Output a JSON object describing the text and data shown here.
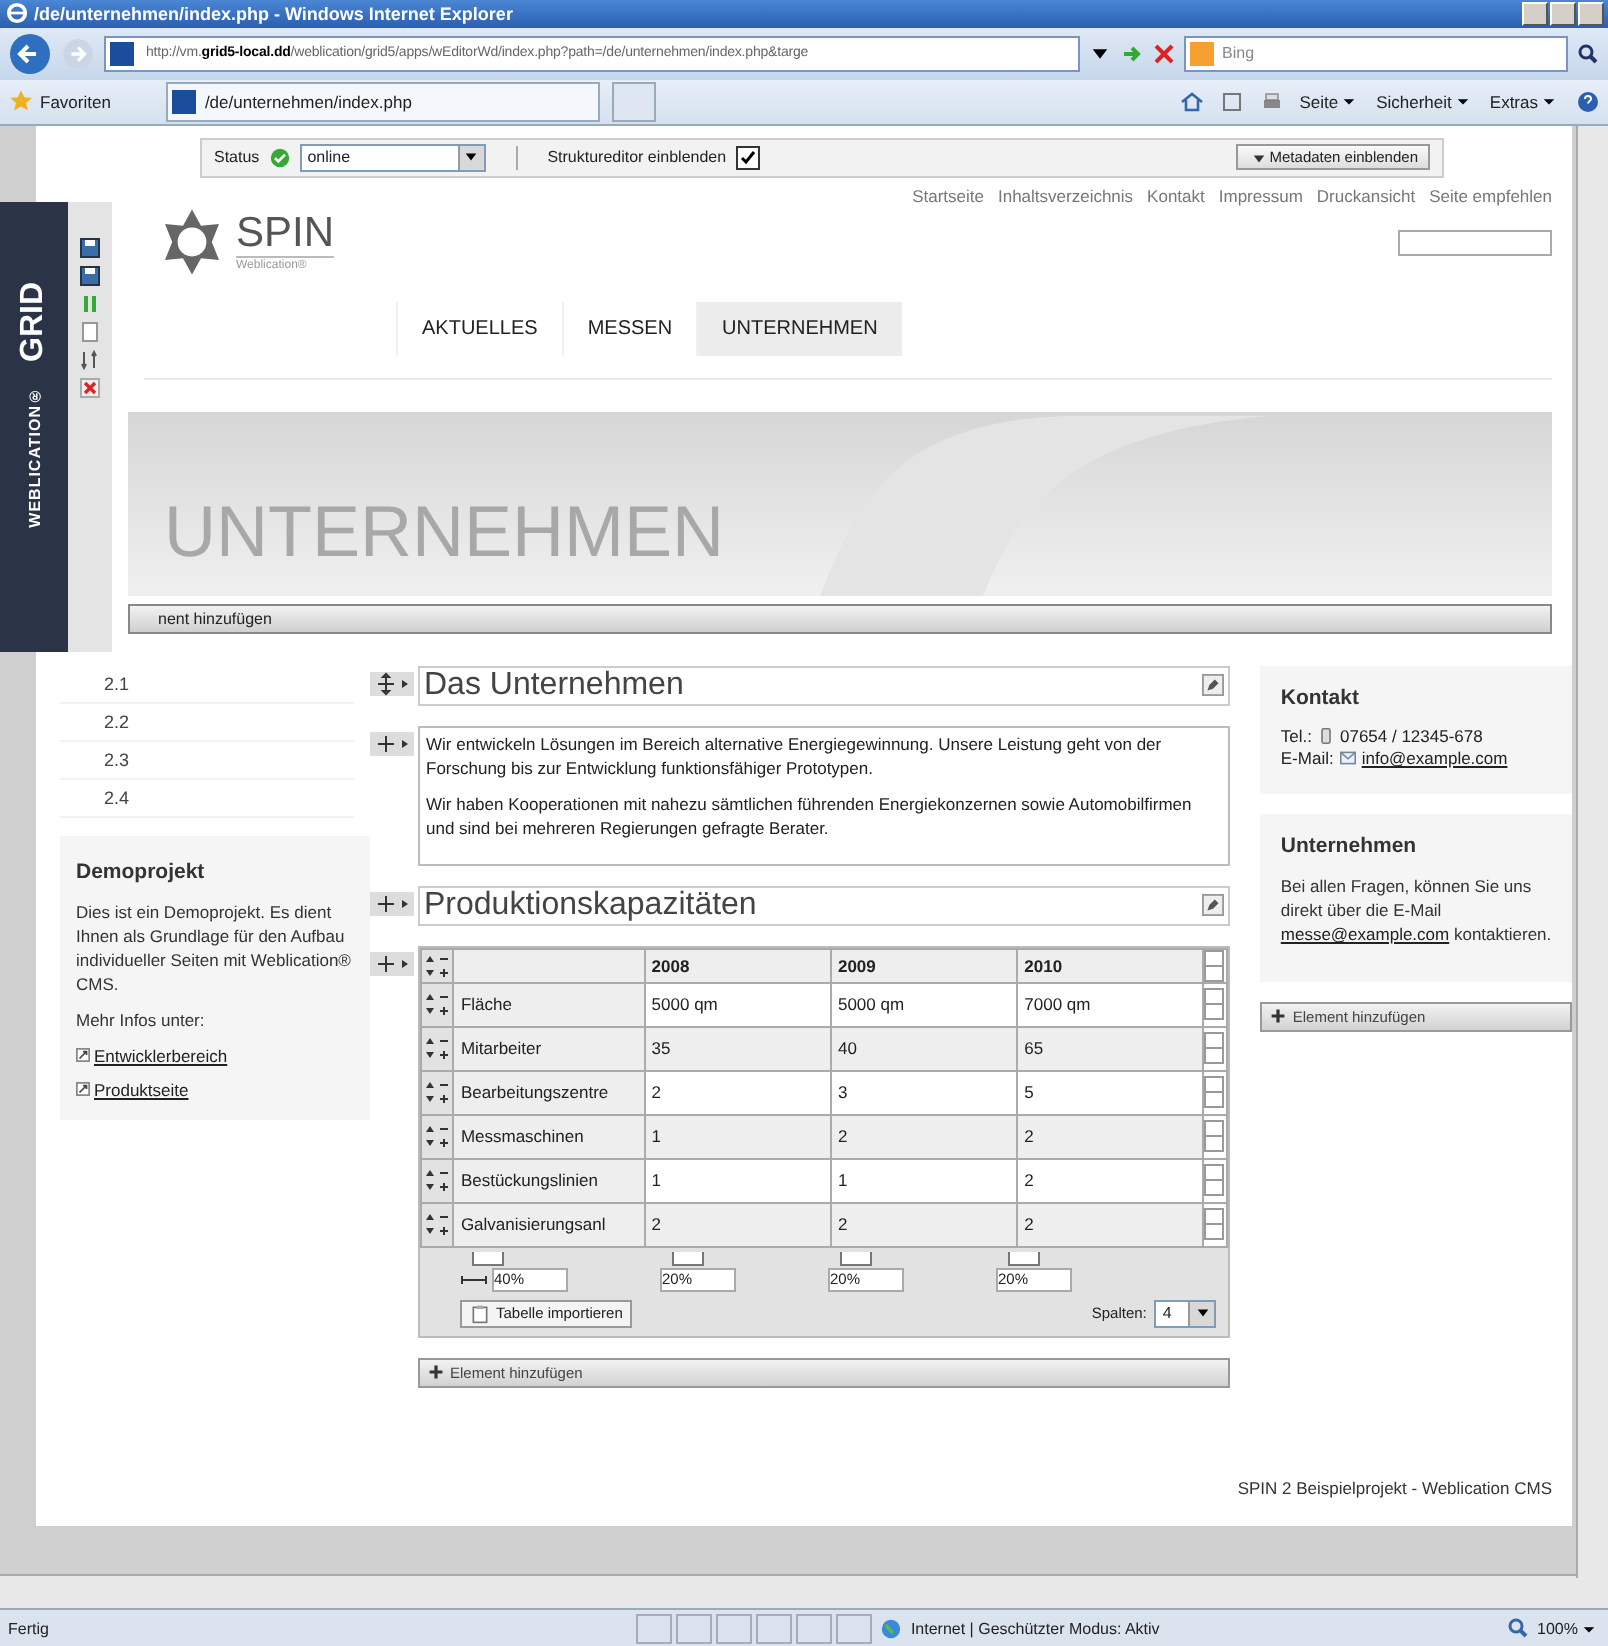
{
  "window": {
    "title": "/de/unternehmen/index.php - Windows Internet Explorer"
  },
  "address_bar": {
    "url": "http://vm.**grid5-local.dd**/weblication/grid5/apps/wEditorWd/index.php?path=/de/unternehmen/index.php&targe"
  },
  "search": {
    "placeholder": "Bing"
  },
  "favorites": {
    "label": "Favoriten",
    "tab": "/de/unternehmen/index.php"
  },
  "command_bar": [
    "Seite",
    "Sicherheit",
    "Extras"
  ],
  "editor_toolbar": {
    "status_label": "Status",
    "status_value": "online",
    "structure_label": "Struktureditor einblenden",
    "structure_checked": true,
    "metadata_button": "Metadaten einblenden"
  },
  "top_links": [
    "Startseite",
    "Inhaltsverzeichnis",
    "Kontakt",
    "Impressum",
    "Druckansicht",
    "Seite empfehlen"
  ],
  "logo": {
    "name": "SPIN",
    "sub": "Weblication®"
  },
  "nav": [
    {
      "label": "AKTUELLES",
      "selected": false
    },
    {
      "label": "MESSEN",
      "selected": false
    },
    {
      "label": "UNTERNEHMEN",
      "selected": true
    }
  ],
  "banner_title": "UNTERNEHMEN",
  "add_element_bar": "nent hinzufügen",
  "grid_panel": {
    "brand": "GRID",
    "vendor": "WEBLICATION®"
  },
  "subnav": [
    "2.1",
    "2.2",
    "2.3",
    "2.4"
  ],
  "demo_box": {
    "title": "Demoprojekt",
    "text": "Dies ist ein Demoprojekt. Es dient Ihnen als Grundlage für den Aufbau individueller Seiten mit Weblication® CMS.",
    "more": "Mehr Infos unter:",
    "links": [
      "Entwicklerbereich",
      "Produktseite"
    ]
  },
  "content": {
    "heading1": "Das Unternehmen",
    "paragraphs": [
      "Wir entwickeln Lösungen im Bereich alternative Energiegewinnung. Unsere Leistung geht von der Forschung bis zur Entwicklung funktionsfähiger Prototypen.",
      "Wir haben Kooperationen mit nahezu sämtlichen führenden Energiekonzernen sowie Automobilfirmen und sind bei mehreren Regierungen gefragte Berater."
    ],
    "heading2": "Produktionskapazitäten",
    "table": {
      "columns": [
        "2008",
        "2009",
        "2010"
      ],
      "rows": [
        {
          "label": "Fläche",
          "cells": [
            "5000 qm",
            "5000 qm",
            "7000 qm"
          ]
        },
        {
          "label": "Mitarbeiter",
          "cells": [
            "35",
            "40",
            "65"
          ]
        },
        {
          "label": "Bearbeitungszentre",
          "cells": [
            "2",
            "3",
            "5"
          ]
        },
        {
          "label": "Messmaschinen",
          "cells": [
            "1",
            "2",
            "2"
          ]
        },
        {
          "label": "Bestückungslinien",
          "cells": [
            "1",
            "1",
            "2"
          ]
        },
        {
          "label": "Galvanisierungsanl",
          "cells": [
            "2",
            "2",
            "2"
          ]
        }
      ],
      "widths": [
        "40%",
        "20%",
        "20%",
        "20%"
      ],
      "import_button": "Tabelle importieren",
      "columns_label": "Spalten:",
      "columns_value": "4"
    },
    "add_button": "Element hinzufügen"
  },
  "contact": {
    "title": "Kontakt",
    "phone_label": "Tel.:",
    "phone": "07654 / 12345-678",
    "email_label": "E-Mail:",
    "email": "info@example.com"
  },
  "company": {
    "title": "Unternehmen",
    "text_before": "Bei allen Fragen, können Sie uns direkt über die E-Mail",
    "email": "messe@example.com",
    "text_after": "kontaktieren."
  },
  "right_add_button": "Element hinzufügen",
  "footer": "SPIN 2 Beispielprojekt - Weblication CMS",
  "status_bar": {
    "text": "Fertig",
    "zone": "Internet | Geschützter Modus: Aktiv",
    "zoom": "100%"
  }
}
